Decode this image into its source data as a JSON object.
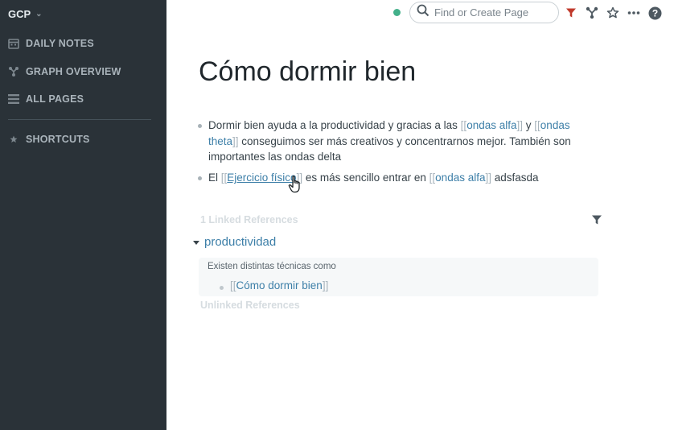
{
  "sidebar": {
    "graph_name": "GCP",
    "items": [
      {
        "label": "DAILY NOTES",
        "icon": "calendar-icon"
      },
      {
        "label": "GRAPH OVERVIEW",
        "icon": "graph-icon"
      },
      {
        "label": "ALL PAGES",
        "icon": "list-icon"
      }
    ],
    "shortcuts_label": "SHORTCUTS",
    "shortcuts_icon": "star-icon"
  },
  "topbar": {
    "status_color": "#43b08a",
    "search_placeholder": "Find or Create Page",
    "icons": [
      "filter-icon",
      "graph-icon",
      "star-icon",
      "more-icon",
      "help-icon"
    ]
  },
  "page": {
    "title": "Cómo dormir bien",
    "blocks": [
      {
        "t1": "Dormir bien ayuda a la productividad y gracias a las ",
        "link1": "ondas alfa",
        "t2": " y ",
        "link2": "ondas theta",
        "t3": " conseguimos ser más creativos y concentrarnos mejor. También son importantes las ondas delta"
      },
      {
        "t1": "El ",
        "link1": "Ejercicio físico",
        "t2": " es más sencillo entrar en ",
        "link2": "ondas alfa",
        "t3": " adsfasda"
      }
    ],
    "brackets": {
      "open": "[[",
      "close": "]]"
    }
  },
  "references": {
    "linked_label": "1 Linked References",
    "group_page": "productividad",
    "parent_text": "Existen distintas técnicas como",
    "child_link": "Cómo dormir bien",
    "unlinked_label": "Unlinked References"
  },
  "colors": {
    "sidebar_bg": "#2a3238",
    "link": "#3d7fa8",
    "filter_active": "#c0392b"
  }
}
